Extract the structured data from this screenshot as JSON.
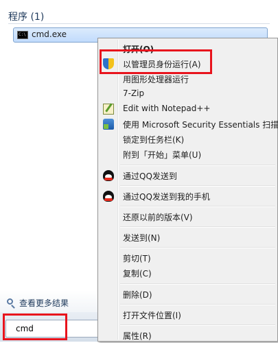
{
  "start_menu": {
    "section_header": "程序 (1)",
    "program": {
      "label": "cmd.exe",
      "icon": "cmd-icon"
    },
    "see_more": "查看更多结果",
    "search_value": "cmd"
  },
  "context_menu": {
    "items": [
      {
        "label": "打开(O)",
        "bold": true
      },
      {
        "label": "以管理员身份运行(A)",
        "icon": "uac-shield-icon"
      },
      {
        "label": "用图形处理器运行"
      },
      {
        "label": "7-Zip"
      },
      {
        "label": "Edit with Notepad++",
        "icon": "notepad-plus-plus-icon"
      },
      {
        "label": "使用 Microsoft Security Essentials 扫描...",
        "icon": "security-essentials-icon"
      },
      {
        "label": "锁定到任务栏(K)"
      },
      {
        "label": "附到「开始」菜单(U)"
      },
      {
        "label": "通过QQ发送到",
        "icon": "qq-penguin-icon"
      },
      {
        "label": "通过QQ发送到我的手机",
        "icon": "qq-penguin-icon"
      },
      {
        "label": "还原以前的版本(V)"
      },
      {
        "label": "发送到(N)"
      },
      {
        "label": "剪切(T)"
      },
      {
        "label": "复制(C)"
      },
      {
        "label": "删除(D)"
      },
      {
        "label": "打开文件位置(I)"
      },
      {
        "label": "属性(R)"
      }
    ]
  },
  "colors": {
    "highlight": "#e8131c",
    "selection": "#c1dbfc"
  }
}
